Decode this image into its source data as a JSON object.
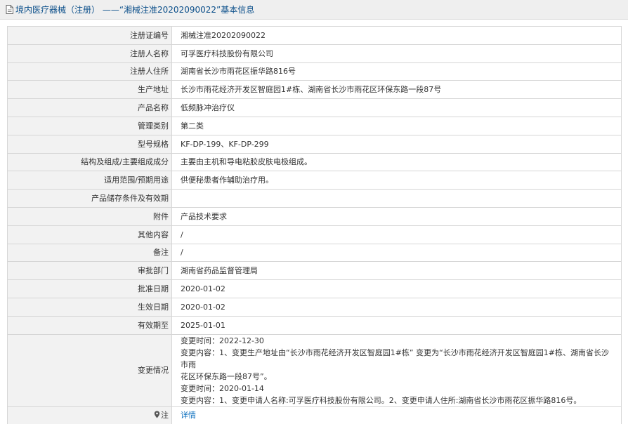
{
  "header": {
    "title": "境内医疗器械（注册） ——“湘械注准20202090022”基本信息",
    "icon": "document-icon"
  },
  "fields": [
    {
      "key": "reg_no",
      "label": "注册证编号",
      "value": "湘械注准20202090022"
    },
    {
      "key": "registrant",
      "label": "注册人名称",
      "value": "可孚医疗科技股份有限公司"
    },
    {
      "key": "registrant_address",
      "label": "注册人住所",
      "value": "湖南省长沙市雨花区振华路816号"
    },
    {
      "key": "production_address",
      "label": "生产地址",
      "value": "长沙市雨花经济开发区智庭园1#栋、湖南省长沙市雨花区环保东路一段87号"
    },
    {
      "key": "product_name",
      "label": "产品名称",
      "value": "低频脉冲治疗仪"
    },
    {
      "key": "management_class",
      "label": "管理类别",
      "value": "第二类"
    },
    {
      "key": "model_spec",
      "label": "型号规格",
      "value": "KF-DP-199、KF-DP-299"
    },
    {
      "key": "structure",
      "label": "结构及组成/主要组成成分",
      "value": "主要由主机和导电粘胶皮肤电极组成。"
    },
    {
      "key": "intended_use",
      "label": "适用范围/预期用途",
      "value": "供便秘患者作辅助治疗用。"
    },
    {
      "key": "storage",
      "label": "产品储存条件及有效期",
      "value": ""
    },
    {
      "key": "attachment",
      "label": "附件",
      "value": "产品技术要求"
    },
    {
      "key": "other",
      "label": "其他内容",
      "value": "/"
    },
    {
      "key": "remark",
      "label": "备注",
      "value": "/"
    },
    {
      "key": "approval_dept",
      "label": "审批部门",
      "value": "湖南省药品监督管理局"
    },
    {
      "key": "approval_date",
      "label": "批准日期",
      "value": "2020-01-02"
    },
    {
      "key": "effective_date",
      "label": "生效日期",
      "value": "2020-01-02"
    },
    {
      "key": "expiry_date",
      "label": "有效期至",
      "value": "2025-01-01"
    }
  ],
  "changes": {
    "label": "变更情况",
    "lines": [
      "变更时间：2022-12-30",
      "变更内容：1、变更生产地址由“长沙市雨花经济开发区智庭园1#栋” 变更为“长沙市雨花经济开发区智庭园1#栋、湖南省长沙市雨",
      "花区环保东路一段87号”。",
      "变更时间：2020-01-14",
      "变更内容：1、变更申请人名称:可孚医疗科技股份有限公司。2、变更申请人住所:湖南省长沙市雨花区振华路816号。"
    ]
  },
  "note": {
    "label": "注",
    "icon": "note-marker-icon",
    "link_text": "详情"
  }
}
